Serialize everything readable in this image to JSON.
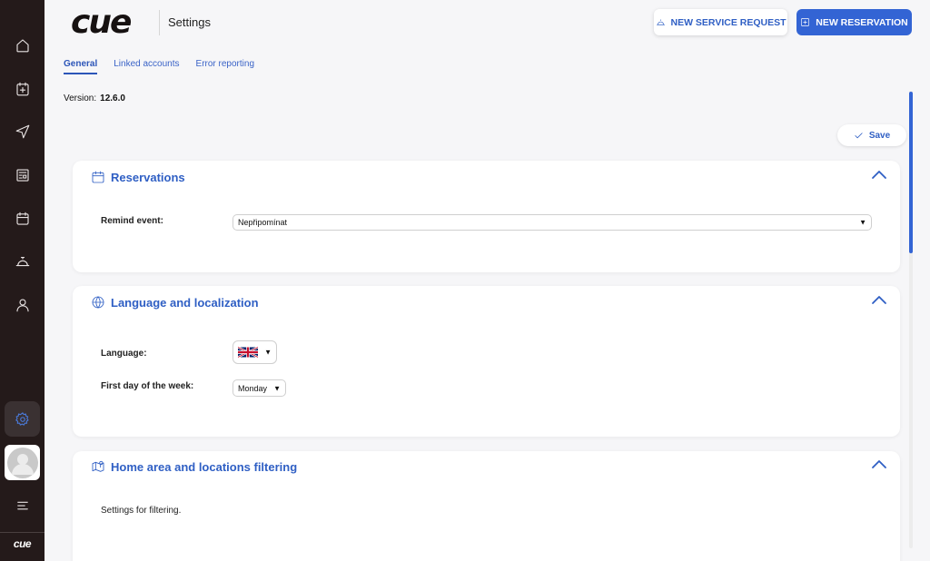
{
  "app": {
    "logo_text": "cue",
    "page_title": "Settings"
  },
  "sidebar": {
    "items": [
      {
        "name": "home-icon"
      },
      {
        "name": "new-reservation-icon"
      },
      {
        "name": "navigation-icon"
      },
      {
        "name": "news-icon"
      },
      {
        "name": "calendar-icon"
      },
      {
        "name": "service-bell-icon"
      },
      {
        "name": "user-icon"
      }
    ],
    "active": "settings-gear-icon",
    "footer_logo": "cue"
  },
  "header": {
    "service_request_label": "NEW SERVICE REQUEST",
    "new_reservation_label": "NEW RESERVATION"
  },
  "tabs": [
    {
      "label": "General",
      "active": true
    },
    {
      "label": "Linked accounts",
      "active": false
    },
    {
      "label": "Error reporting",
      "active": false
    }
  ],
  "version": {
    "label": "Version:",
    "value": "12.6.0"
  },
  "save_label": "Save",
  "sections": {
    "reservations": {
      "title": "Reservations",
      "remind_label": "Remind event:",
      "remind_value": "Nepřipomínat"
    },
    "language": {
      "title": "Language and localization",
      "language_label": "Language:",
      "first_day_label": "First day of the week:",
      "first_day_value": "Monday"
    },
    "home_area": {
      "title": "Home area and locations filtering",
      "description": "Settings for filtering."
    }
  },
  "colors": {
    "accent": "#3364d4",
    "sidebar_bg": "#241a1a",
    "page_bg": "#f6f6f8"
  }
}
